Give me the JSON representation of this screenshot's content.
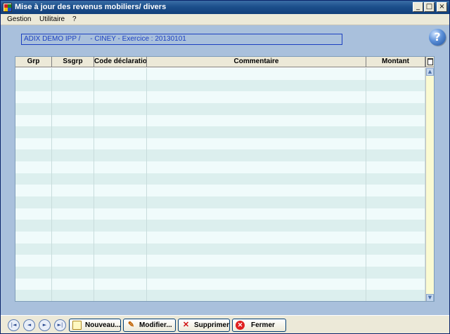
{
  "window": {
    "title": "Mise à jour des revenus mobiliers/ divers",
    "minimize": "_",
    "maximize": "□",
    "close": "×"
  },
  "menu": {
    "items": [
      {
        "label": "Gestion"
      },
      {
        "label": "Utilitaire"
      },
      {
        "label": "?"
      }
    ]
  },
  "info": {
    "text": "ADIX DEMO IPP /     - CINEY - Exercice : 20130101"
  },
  "help_icon": {
    "glyph": "?"
  },
  "table": {
    "columns": [
      "Grp",
      "Ssgrp",
      "Code déclaration",
      "Commentaire",
      "Montant"
    ],
    "rows": []
  },
  "toolbar": {
    "nav": [
      {
        "glyph": "|◄"
      },
      {
        "glyph": "◄"
      },
      {
        "glyph": "►"
      },
      {
        "glyph": "►|"
      }
    ],
    "nouveau_label": "Nouveau...",
    "modifier_label": "Modifier...",
    "supprimer_label": "Supprimer",
    "fermer_label": "Fermer"
  },
  "colors": {
    "client_bg": "#a9c0dc",
    "row_odd": "#f0fbfb",
    "row_even": "#dcefee",
    "info_text": "#1b3fc0"
  }
}
